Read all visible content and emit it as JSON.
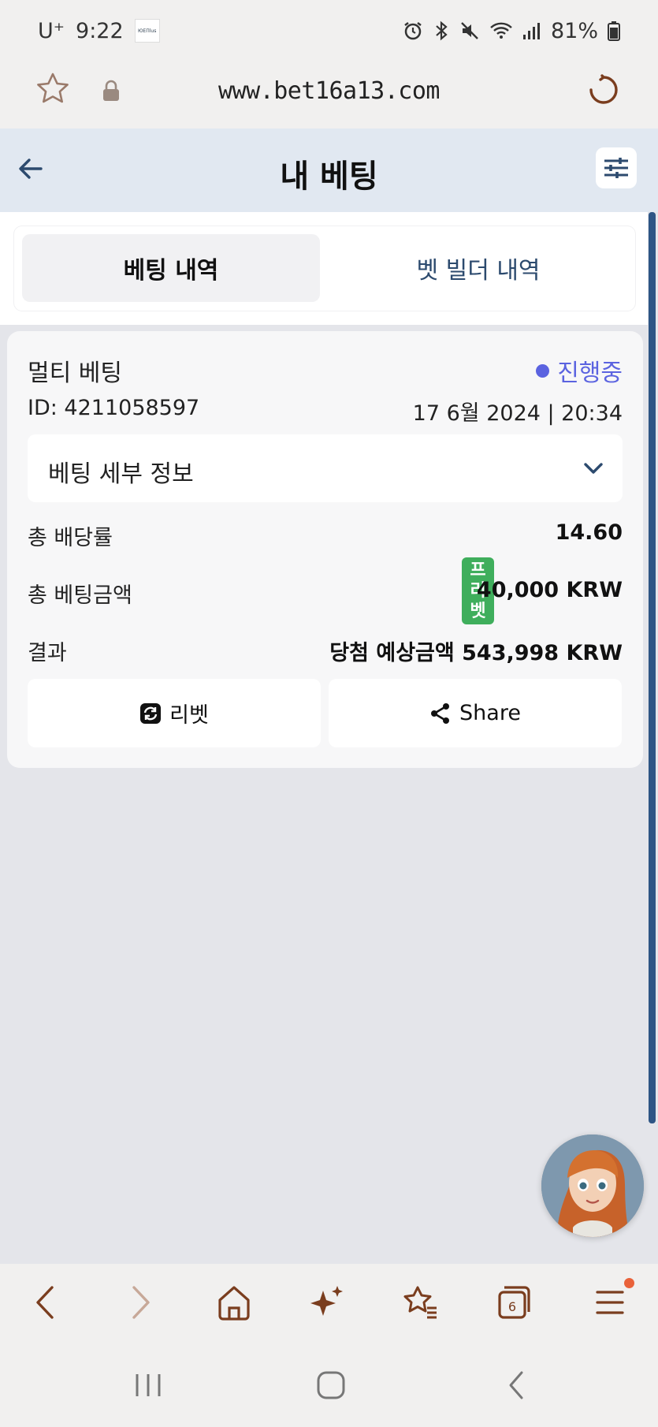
{
  "status_bar": {
    "carrier": "U⁺",
    "time": "9:22",
    "carrier_logo_text": "ЮЕПlus",
    "battery": "81%"
  },
  "browser": {
    "url": "www.bet16a13.com"
  },
  "header": {
    "title": "내 베팅"
  },
  "tabs": [
    {
      "label": "베팅 내역",
      "active": true
    },
    {
      "label": "벳 빌더 내역",
      "active": false
    }
  ],
  "bet": {
    "type": "멀티 베팅",
    "status": "진행중",
    "id": "ID: 4211058597",
    "datetime": "17 6월 2024 | 20:34",
    "details_label": "베팅 세부 정보",
    "odds_label": "총 배당률",
    "odds_value": "14.60",
    "stake_label": "총 베팅금액",
    "freebet_badge": [
      "프",
      "리",
      "벳"
    ],
    "stake_value": "40,000 KRW",
    "result_label": "결과",
    "result_value": "당첨 예상금액 543,998 KRW",
    "rebet_label": "리벳",
    "share_label": "Share"
  },
  "bottom_toolbar": {
    "tabs_count": "6"
  },
  "colors": {
    "accent_status": "#5b63e0",
    "header_bg": "#e1e8f1",
    "freebet_green": "#3fae5c",
    "scrollbar": "#2e5585",
    "browser_icon": "#7a3d1e"
  }
}
